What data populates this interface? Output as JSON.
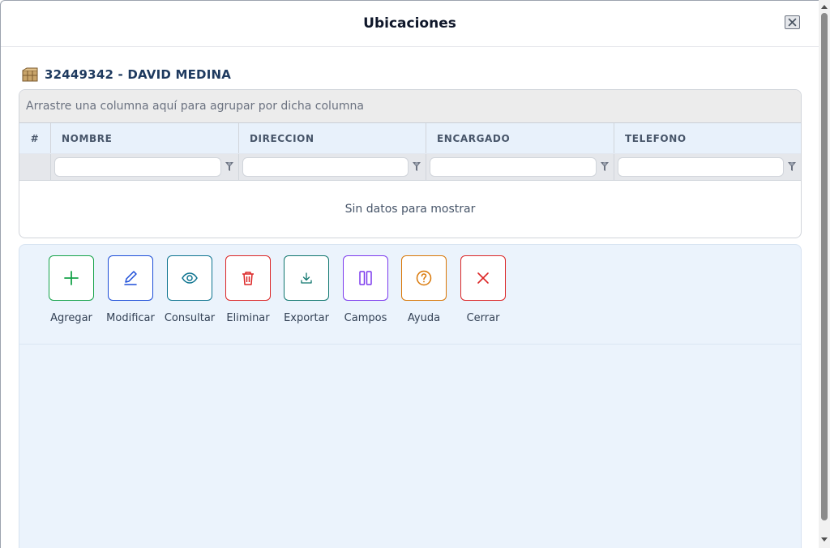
{
  "dialog": {
    "title": "Ubicaciones"
  },
  "customer": {
    "heading": "32449342 - DAVID MEDINA"
  },
  "grid": {
    "group_hint": "Arrastre una columna aquí para agrupar por dicha columna",
    "columns": [
      "#",
      "NOMBRE",
      "DIRECCION",
      "ENCARGADO",
      "TELEFONO"
    ],
    "filters": [
      "",
      "",
      "",
      ""
    ],
    "empty_message": "Sin datos para mostrar"
  },
  "toolbar": {
    "buttons": [
      {
        "label": "Agregar",
        "icon": "plus-icon",
        "color": "#16a34a"
      },
      {
        "label": "Modificar",
        "icon": "pencil-icon",
        "color": "#1d4ed8"
      },
      {
        "label": "Consultar",
        "icon": "eye-icon",
        "color": "#0e7490"
      },
      {
        "label": "Eliminar",
        "icon": "trash-icon",
        "color": "#dc2626"
      },
      {
        "label": "Exportar",
        "icon": "download-icon",
        "color": "#0f766e"
      },
      {
        "label": "Campos",
        "icon": "columns-icon",
        "color": "#7c3aed"
      },
      {
        "label": "Ayuda",
        "icon": "question-icon",
        "color": "#d97706"
      },
      {
        "label": "Cerrar",
        "icon": "close-icon",
        "color": "#dc2626"
      }
    ]
  }
}
